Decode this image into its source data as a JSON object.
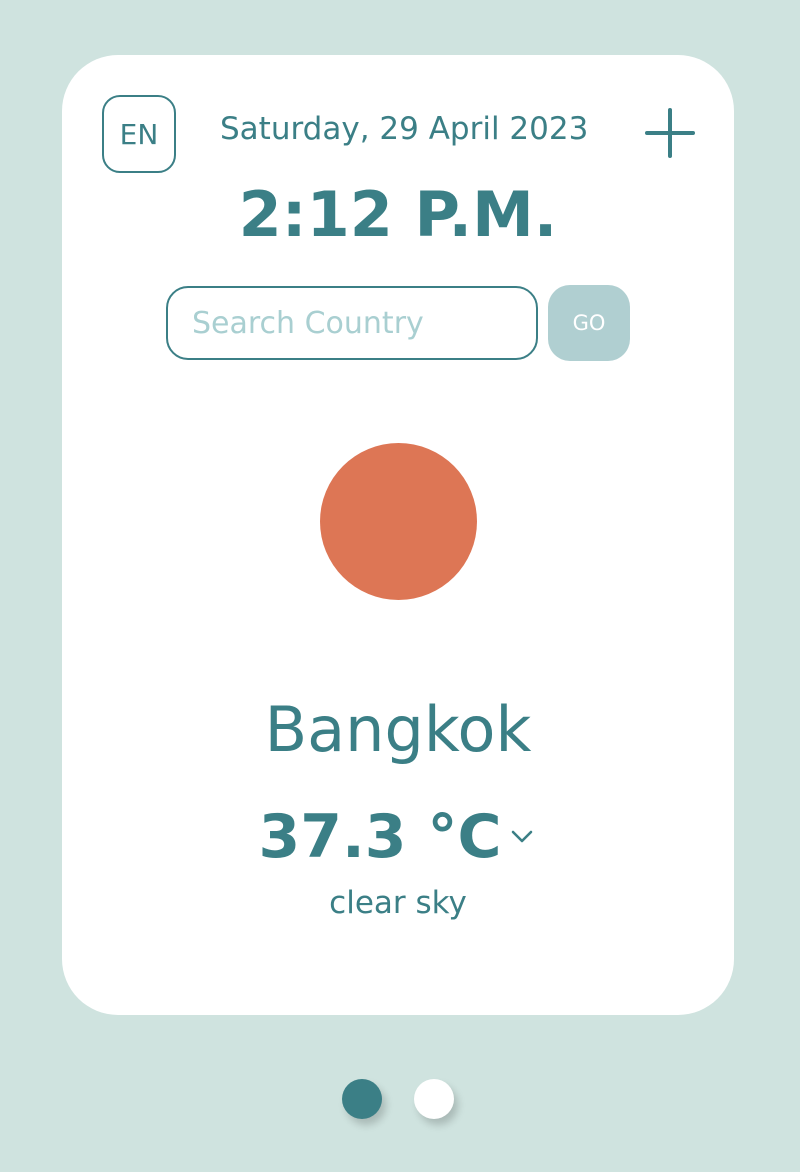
{
  "header": {
    "language": "EN",
    "date": "Saturday, 29 April 2023",
    "add_icon": "plus-icon"
  },
  "clock": {
    "time": "2:12 P.M."
  },
  "search": {
    "placeholder": "Search Country",
    "value": "",
    "go_label": "GO"
  },
  "weather": {
    "icon": "sun-icon",
    "city": "Bangkok",
    "temperature": "37.3 °C",
    "unit_toggle_icon": "chevron-down-icon",
    "description": "clear sky"
  },
  "pagination": {
    "pages": 2,
    "active_page": 1
  },
  "colors": {
    "background": "#cfe3df",
    "card": "#ffffff",
    "accent": "#3b7f86",
    "sun": "#dd7655",
    "go_button": "#b0cfd1",
    "placeholder": "#a9cfd1"
  }
}
